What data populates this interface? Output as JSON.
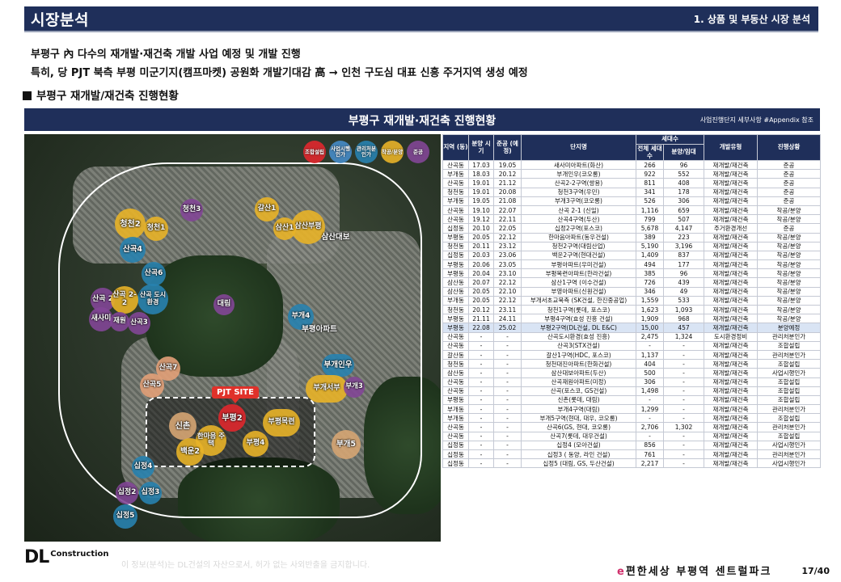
{
  "header": {
    "title": "시장분석",
    "subtitle": "1. 상품 및 부동산 시장 분석"
  },
  "bullets": [
    "부평구 內 다수의 재개발·재건축 개발 사업 예정 및 개발 진행",
    "특히, 당 PJT 북측 부평 미군기지(캠프마켓) 공원화 개발기대감 高 → 인천 구도심 대표 신흥 주거지역 생성 예정"
  ],
  "section_title": "부평구 재개발/재건축 진행현황",
  "panel": {
    "title": "부평구 재개발·재건축 진행현황",
    "note": "사업진행단지 세부사항 #Appendix 참조"
  },
  "map": {
    "legend": [
      "조합설립",
      "사업시행 인가",
      "관리처분 인가",
      "착공/분양",
      "준공"
    ],
    "pjt_label": "PJT SITE",
    "labels": {
      "cheongcheon2": "청천2",
      "cheongcheon1": "청천1",
      "cheongcheon3": "청천3",
      "galsan1": "갈산1",
      "samsan_bupyeong": "삼산부평",
      "samsan1": "삼산1",
      "samsan_daebo": "삼산대보",
      "sangok4": "산곡4",
      "sangok6": "산곡6",
      "sangok_dosi": "산곡 도시 환경",
      "sangok2": "산곡 2",
      "sangok22": "산곡 2-2",
      "saemaeul": "새사미",
      "jaewon": "재원",
      "sangok3": "산곡3",
      "daelim": "대림",
      "bugae4": "부개4",
      "bupyeong_apt": "부평아파트",
      "bugae_inwoo": "부개인우",
      "sangok7": "산곡7",
      "sangok5": "산곡5",
      "bugae_seobu": "부개서부",
      "bugae3": "부개3",
      "bupyeong2": "부평2",
      "bupyeong_ro": "부평목련",
      "sinchon": "신촌",
      "hanmaeum": "한마음 주택",
      "bupyeong4": "부평4",
      "baekun2": "백운2",
      "bugae5": "부개5",
      "sipjeong4": "십정4",
      "sipjeong2": "십정2",
      "sipjeong3": "십정3",
      "sipjeong5": "십정5"
    }
  },
  "table": {
    "headers": {
      "region": "지역 (동)",
      "sale_period": "분양 시기",
      "completion": "준공 (예정)",
      "name": "단지명",
      "households": "세대수",
      "total": "전체 세대수",
      "sale_lease": "분양/임대",
      "type": "개발유형",
      "status": "진행상황"
    },
    "rows": [
      [
        "산곡동",
        "17.03",
        "19.05",
        "새사미아파트(화산)",
        "266",
        "96",
        "재개발/재건축",
        "준공"
      ],
      [
        "부개동",
        "18.03",
        "20.12",
        "부개인우(코오롱)",
        "922",
        "552",
        "재개발/재건축",
        "준공"
      ],
      [
        "산곡동",
        "19.01",
        "21.12",
        "산곡2-2구역(쌍용)",
        "811",
        "408",
        "재개발/재건축",
        "준공"
      ],
      [
        "청천동",
        "19.01",
        "20.08",
        "청천3구역(우민)",
        "341",
        "178",
        "재개발/재건축",
        "준공"
      ],
      [
        "부개동",
        "19.05",
        "21.08",
        "부개3구역(코오롱)",
        "526",
        "306",
        "재개발/재건축",
        "준공"
      ],
      [
        "산곡동",
        "19.10",
        "22.07",
        "산곡 2-1 (신일)",
        "1,116",
        "659",
        "재개발/재건축",
        "착공/분양"
      ],
      [
        "산곡동",
        "19.12",
        "22.11",
        "산곡4구역(두산)",
        "799",
        "507",
        "재개발/재건축",
        "착공/분양"
      ],
      [
        "십정동",
        "20.10",
        "22.05",
        "십정2구역(포스코)",
        "5,678",
        "4,147",
        "주거환경개선",
        "준공"
      ],
      [
        "부평동",
        "20.05",
        "22.12",
        "한마음아파트(동우건설)",
        "389",
        "223",
        "재개발/재건축",
        "착공/분양"
      ],
      [
        "청천동",
        "20.11",
        "23.12",
        "청천2구역(대림산업)",
        "5,190",
        "3,196",
        "재개발/재건축",
        "착공/분양"
      ],
      [
        "십정동",
        "20.03",
        "23.06",
        "백운2구역(현대건설)",
        "1,409",
        "837",
        "재개발/재건축",
        "착공/분양"
      ],
      [
        "부평동",
        "20.06",
        "23.05",
        "부평아파트(우미건설)",
        "494",
        "177",
        "재개발/재건축",
        "착공/분양"
      ],
      [
        "부평동",
        "20.04",
        "23.10",
        "부평목련아파트(한라건설)",
        "385",
        "96",
        "재개발/재건축",
        "착공/분양"
      ],
      [
        "삼산동",
        "20.07",
        "22.12",
        "삼산1구역 (이수건설)",
        "726",
        "439",
        "재개발/재건축",
        "착공/분양"
      ],
      [
        "삼산동",
        "20.05",
        "22.10",
        "부영아파트(신원건설)",
        "346",
        "49",
        "재개발/재건축",
        "착공/분양"
      ],
      [
        "부개동",
        "20.05",
        "22.12",
        "부개서초교북측 (SK건설, 한진중공업)",
        "1,559",
        "533",
        "재개발/재건축",
        "착공/분양"
      ],
      [
        "청천동",
        "20.12",
        "23.11",
        "청천1구역(롯데, 포스코)",
        "1,623",
        "1,093",
        "재개발/재건축",
        "착공/분양"
      ],
      [
        "부평동",
        "21.11",
        "24.11",
        "부평4구역(효성 진흥 건설)",
        "1,909",
        "968",
        "재개발/재건축",
        "착공/분양"
      ],
      [
        "부평동",
        "22.08",
        "25.02",
        "부평2구역(DL건설, DL E&C)",
        "15,00",
        "457",
        "재개발/재건축",
        "분양예정"
      ],
      [
        "산곡동",
        "-",
        "-",
        "산곡도시환경(효성 진흥)",
        "2,475",
        "1,324",
        "도시환경정비",
        "관리처분인가"
      ],
      [
        "산곡동",
        "-",
        "-",
        "산곡3(STX건설)",
        "-",
        "-",
        "재개발/재건축",
        "조합설립"
      ],
      [
        "갈산동",
        "-",
        "-",
        "갈산1구역(HDC, 포스코)",
        "1,137",
        "-",
        "재개발/재건축",
        "관리처분인가"
      ],
      [
        "청천동",
        "-",
        "-",
        "청천대진아파트(한화건설)",
        "404",
        "-",
        "재개발/재건축",
        "조합설립"
      ],
      [
        "삼산동",
        "-",
        "-",
        "삼산대보아파트(두산)",
        "500",
        "-",
        "재개발/재건축",
        "사업시행인가"
      ],
      [
        "산곡동",
        "-",
        "-",
        "산곡재원아파트(미정)",
        "306",
        "-",
        "재개발/재건축",
        "조합설립"
      ],
      [
        "산곡동",
        "-",
        "-",
        "산곡(포스코, GS건설)",
        "1,498",
        "-",
        "재개발/재건축",
        "조합설립"
      ],
      [
        "부평동",
        "-",
        "-",
        "신촌(롯데, 대림)",
        "-",
        "-",
        "재개발/재건축",
        "조합설립"
      ],
      [
        "부개동",
        "-",
        "-",
        "부개4구역(대림)",
        "1,299",
        "-",
        "재개발/재건축",
        "관리처분인가"
      ],
      [
        "부개동",
        "-",
        "-",
        "부개5구역(현대, 대우, 코오롱)",
        "-",
        "-",
        "재개발/재건축",
        "조합설립"
      ],
      [
        "산곡동",
        "-",
        "-",
        "산곡6(GS, 현대, 코오롱)",
        "2,706",
        "1,302",
        "재개발/재건축",
        "관리처분인가"
      ],
      [
        "산곡동",
        "-",
        "-",
        "산곡7(롯데, 대우건설)",
        "-",
        "-",
        "재개발/재건축",
        "조합설립"
      ],
      [
        "십정동",
        "-",
        "-",
        "십정4 (모아건설)",
        "856",
        "-",
        "재개발/재건축",
        "사업시행인가"
      ],
      [
        "십정동",
        "-",
        "-",
        "십정3 ( 동양, 라인 건설)",
        "761",
        "-",
        "재개발/재건축",
        "관리처분인가"
      ],
      [
        "십정동",
        "-",
        "-",
        "십정5 (대림, GS, 두산건설)",
        "2,217",
        "-",
        "재개발/재건축",
        "사업시행인가"
      ]
    ]
  },
  "footer": {
    "logo": "DL",
    "logo_sub": "Construction",
    "note": "이 정보(분석)는 DL건설의 자산으로서, 허가 없는 사외반출을 금지합니다.",
    "brand_e": "e",
    "brand_rest": "편한세상 부평역 센트럴파크",
    "page": "17/40"
  },
  "colors": {
    "navy": "#1f2f5a",
    "highlight_row": "#d9e4f4",
    "pjt_red": "#e0312a"
  }
}
